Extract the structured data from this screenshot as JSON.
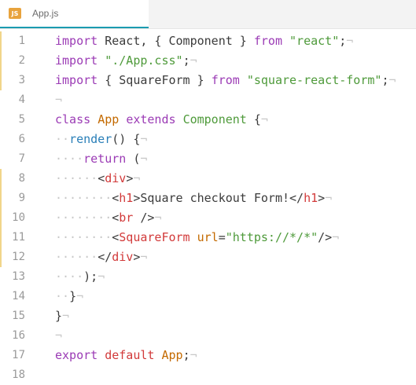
{
  "tab": {
    "icon": "js-file-icon",
    "icon_text": "JS",
    "filename": "App.js"
  },
  "lines": [
    {
      "n": "1",
      "mark": true,
      "tokens": [
        {
          "t": "import",
          "c": "kw"
        },
        {
          "t": " React, { Component } ",
          "c": ""
        },
        {
          "t": "from",
          "c": "kw"
        },
        {
          "t": " ",
          "c": ""
        },
        {
          "t": "\"react\"",
          "c": "str"
        },
        {
          "t": ";",
          "c": ""
        },
        {
          "t": "¬",
          "c": "inv"
        }
      ]
    },
    {
      "n": "2",
      "mark": true,
      "tokens": [
        {
          "t": "import",
          "c": "kw"
        },
        {
          "t": " ",
          "c": ""
        },
        {
          "t": "\"./App.css\"",
          "c": "str"
        },
        {
          "t": ";",
          "c": ""
        },
        {
          "t": "¬",
          "c": "inv"
        }
      ]
    },
    {
      "n": "3",
      "mark": true,
      "tokens": [
        {
          "t": "import",
          "c": "kw"
        },
        {
          "t": " { SquareForm } ",
          "c": ""
        },
        {
          "t": "from",
          "c": "kw"
        },
        {
          "t": " ",
          "c": ""
        },
        {
          "t": "\"square-react-form\"",
          "c": "str"
        },
        {
          "t": ";",
          "c": ""
        },
        {
          "t": "¬",
          "c": "inv"
        }
      ]
    },
    {
      "n": "4",
      "mark": false,
      "tokens": [
        {
          "t": "¬",
          "c": "inv"
        }
      ]
    },
    {
      "n": "5",
      "mark": false,
      "tokens": [
        {
          "t": "class",
          "c": "kw"
        },
        {
          "t": " ",
          "c": ""
        },
        {
          "t": "App",
          "c": "cls"
        },
        {
          "t": " ",
          "c": ""
        },
        {
          "t": "extends",
          "c": "kw"
        },
        {
          "t": " ",
          "c": ""
        },
        {
          "t": "Component",
          "c": "str"
        },
        {
          "t": " {",
          "c": ""
        },
        {
          "t": "¬",
          "c": "inv"
        }
      ]
    },
    {
      "n": "6",
      "mark": false,
      "tokens": [
        {
          "t": "··",
          "c": "ws"
        },
        {
          "t": "render",
          "c": "fn"
        },
        {
          "t": "() {",
          "c": ""
        },
        {
          "t": "¬",
          "c": "inv"
        }
      ]
    },
    {
      "n": "7",
      "mark": false,
      "tokens": [
        {
          "t": "····",
          "c": "ws"
        },
        {
          "t": "return",
          "c": "kw"
        },
        {
          "t": " (",
          "c": ""
        },
        {
          "t": "¬",
          "c": "inv"
        }
      ]
    },
    {
      "n": "8",
      "mark": true,
      "tokens": [
        {
          "t": "······",
          "c": "ws"
        },
        {
          "t": "<",
          "c": ""
        },
        {
          "t": "div",
          "c": "tag"
        },
        {
          "t": ">",
          "c": ""
        },
        {
          "t": "¬",
          "c": "inv"
        }
      ]
    },
    {
      "n": "9",
      "mark": true,
      "tokens": [
        {
          "t": "········",
          "c": "ws"
        },
        {
          "t": "<",
          "c": ""
        },
        {
          "t": "h1",
          "c": "tag"
        },
        {
          "t": ">Square checkout Form!</",
          "c": ""
        },
        {
          "t": "h1",
          "c": "tag"
        },
        {
          "t": ">",
          "c": ""
        },
        {
          "t": "¬",
          "c": "inv"
        }
      ]
    },
    {
      "n": "10",
      "mark": true,
      "tokens": [
        {
          "t": "········",
          "c": "ws"
        },
        {
          "t": "<",
          "c": ""
        },
        {
          "t": "br",
          "c": "tag"
        },
        {
          "t": " />",
          "c": ""
        },
        {
          "t": "¬",
          "c": "inv"
        }
      ]
    },
    {
      "n": "11",
      "mark": true,
      "tokens": [
        {
          "t": "········",
          "c": "ws"
        },
        {
          "t": "<",
          "c": ""
        },
        {
          "t": "SquareForm",
          "c": "tag"
        },
        {
          "t": " ",
          "c": ""
        },
        {
          "t": "url",
          "c": "attr"
        },
        {
          "t": "=",
          "c": ""
        },
        {
          "t": "\"https://*/*\"",
          "c": "str"
        },
        {
          "t": "/>",
          "c": ""
        },
        {
          "t": "¬",
          "c": "inv"
        }
      ]
    },
    {
      "n": "12",
      "mark": true,
      "tokens": [
        {
          "t": "······",
          "c": "ws"
        },
        {
          "t": "</",
          "c": ""
        },
        {
          "t": "div",
          "c": "tag"
        },
        {
          "t": ">",
          "c": ""
        },
        {
          "t": "¬",
          "c": "inv"
        }
      ]
    },
    {
      "n": "13",
      "mark": false,
      "tokens": [
        {
          "t": "····",
          "c": "ws"
        },
        {
          "t": ");",
          "c": ""
        },
        {
          "t": "¬",
          "c": "inv"
        }
      ]
    },
    {
      "n": "14",
      "mark": false,
      "tokens": [
        {
          "t": "··",
          "c": "ws"
        },
        {
          "t": "}",
          "c": ""
        },
        {
          "t": "¬",
          "c": "inv"
        }
      ]
    },
    {
      "n": "15",
      "mark": false,
      "tokens": [
        {
          "t": "}",
          "c": ""
        },
        {
          "t": "¬",
          "c": "inv"
        }
      ]
    },
    {
      "n": "16",
      "mark": false,
      "tokens": [
        {
          "t": "¬",
          "c": "inv"
        }
      ]
    },
    {
      "n": "17",
      "mark": false,
      "tokens": [
        {
          "t": "export",
          "c": "kw"
        },
        {
          "t": " ",
          "c": ""
        },
        {
          "t": "default",
          "c": "tag"
        },
        {
          "t": " ",
          "c": ""
        },
        {
          "t": "App",
          "c": "cls"
        },
        {
          "t": ";",
          "c": ""
        },
        {
          "t": "¬",
          "c": "inv"
        }
      ]
    },
    {
      "n": "18",
      "mark": false,
      "tokens": []
    }
  ],
  "colors": {
    "accent": "#1a9bb0",
    "keyword": "#9b3bb5",
    "string": "#4e9a3a",
    "tag": "#d23a3a",
    "gutter_mark": "#f1d58a"
  }
}
